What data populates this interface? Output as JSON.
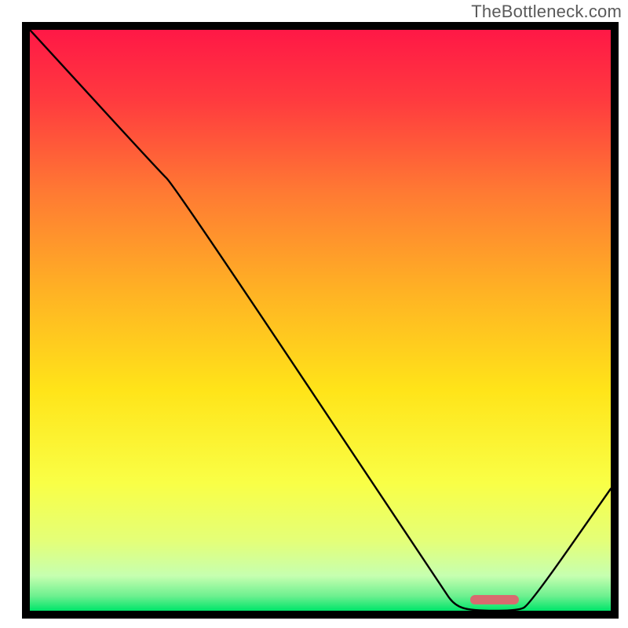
{
  "watermark": "TheBottleneck.com",
  "chart_data": {
    "type": "line",
    "title": "",
    "xlabel": "",
    "ylabel": "",
    "xlim": [
      0,
      100
    ],
    "ylim": [
      0,
      100
    ],
    "background": {
      "type": "vertical-gradient",
      "stops": [
        {
          "pos": 0.0,
          "color": "#ff1846"
        },
        {
          "pos": 0.12,
          "color": "#ff3a3f"
        },
        {
          "pos": 0.28,
          "color": "#ff7a33"
        },
        {
          "pos": 0.45,
          "color": "#ffb224"
        },
        {
          "pos": 0.62,
          "color": "#ffe419"
        },
        {
          "pos": 0.78,
          "color": "#f9ff46"
        },
        {
          "pos": 0.88,
          "color": "#e4ff78"
        },
        {
          "pos": 0.94,
          "color": "#c6ffb0"
        },
        {
          "pos": 0.975,
          "color": "#6cf08f"
        },
        {
          "pos": 1.0,
          "color": "#00e56a"
        }
      ]
    },
    "series": [
      {
        "name": "curve",
        "points": [
          {
            "x": 0,
            "y": 100
          },
          {
            "x": 22,
            "y": 76
          },
          {
            "x": 25,
            "y": 73
          },
          {
            "x": 71,
            "y": 4
          },
          {
            "x": 73,
            "y": 1
          },
          {
            "x": 76,
            "y": 0
          },
          {
            "x": 84,
            "y": 0
          },
          {
            "x": 86,
            "y": 1
          },
          {
            "x": 100,
            "y": 21
          }
        ]
      }
    ],
    "marker": {
      "x_center": 80,
      "width_pct": 8.5,
      "color": "#d86b6f"
    }
  }
}
